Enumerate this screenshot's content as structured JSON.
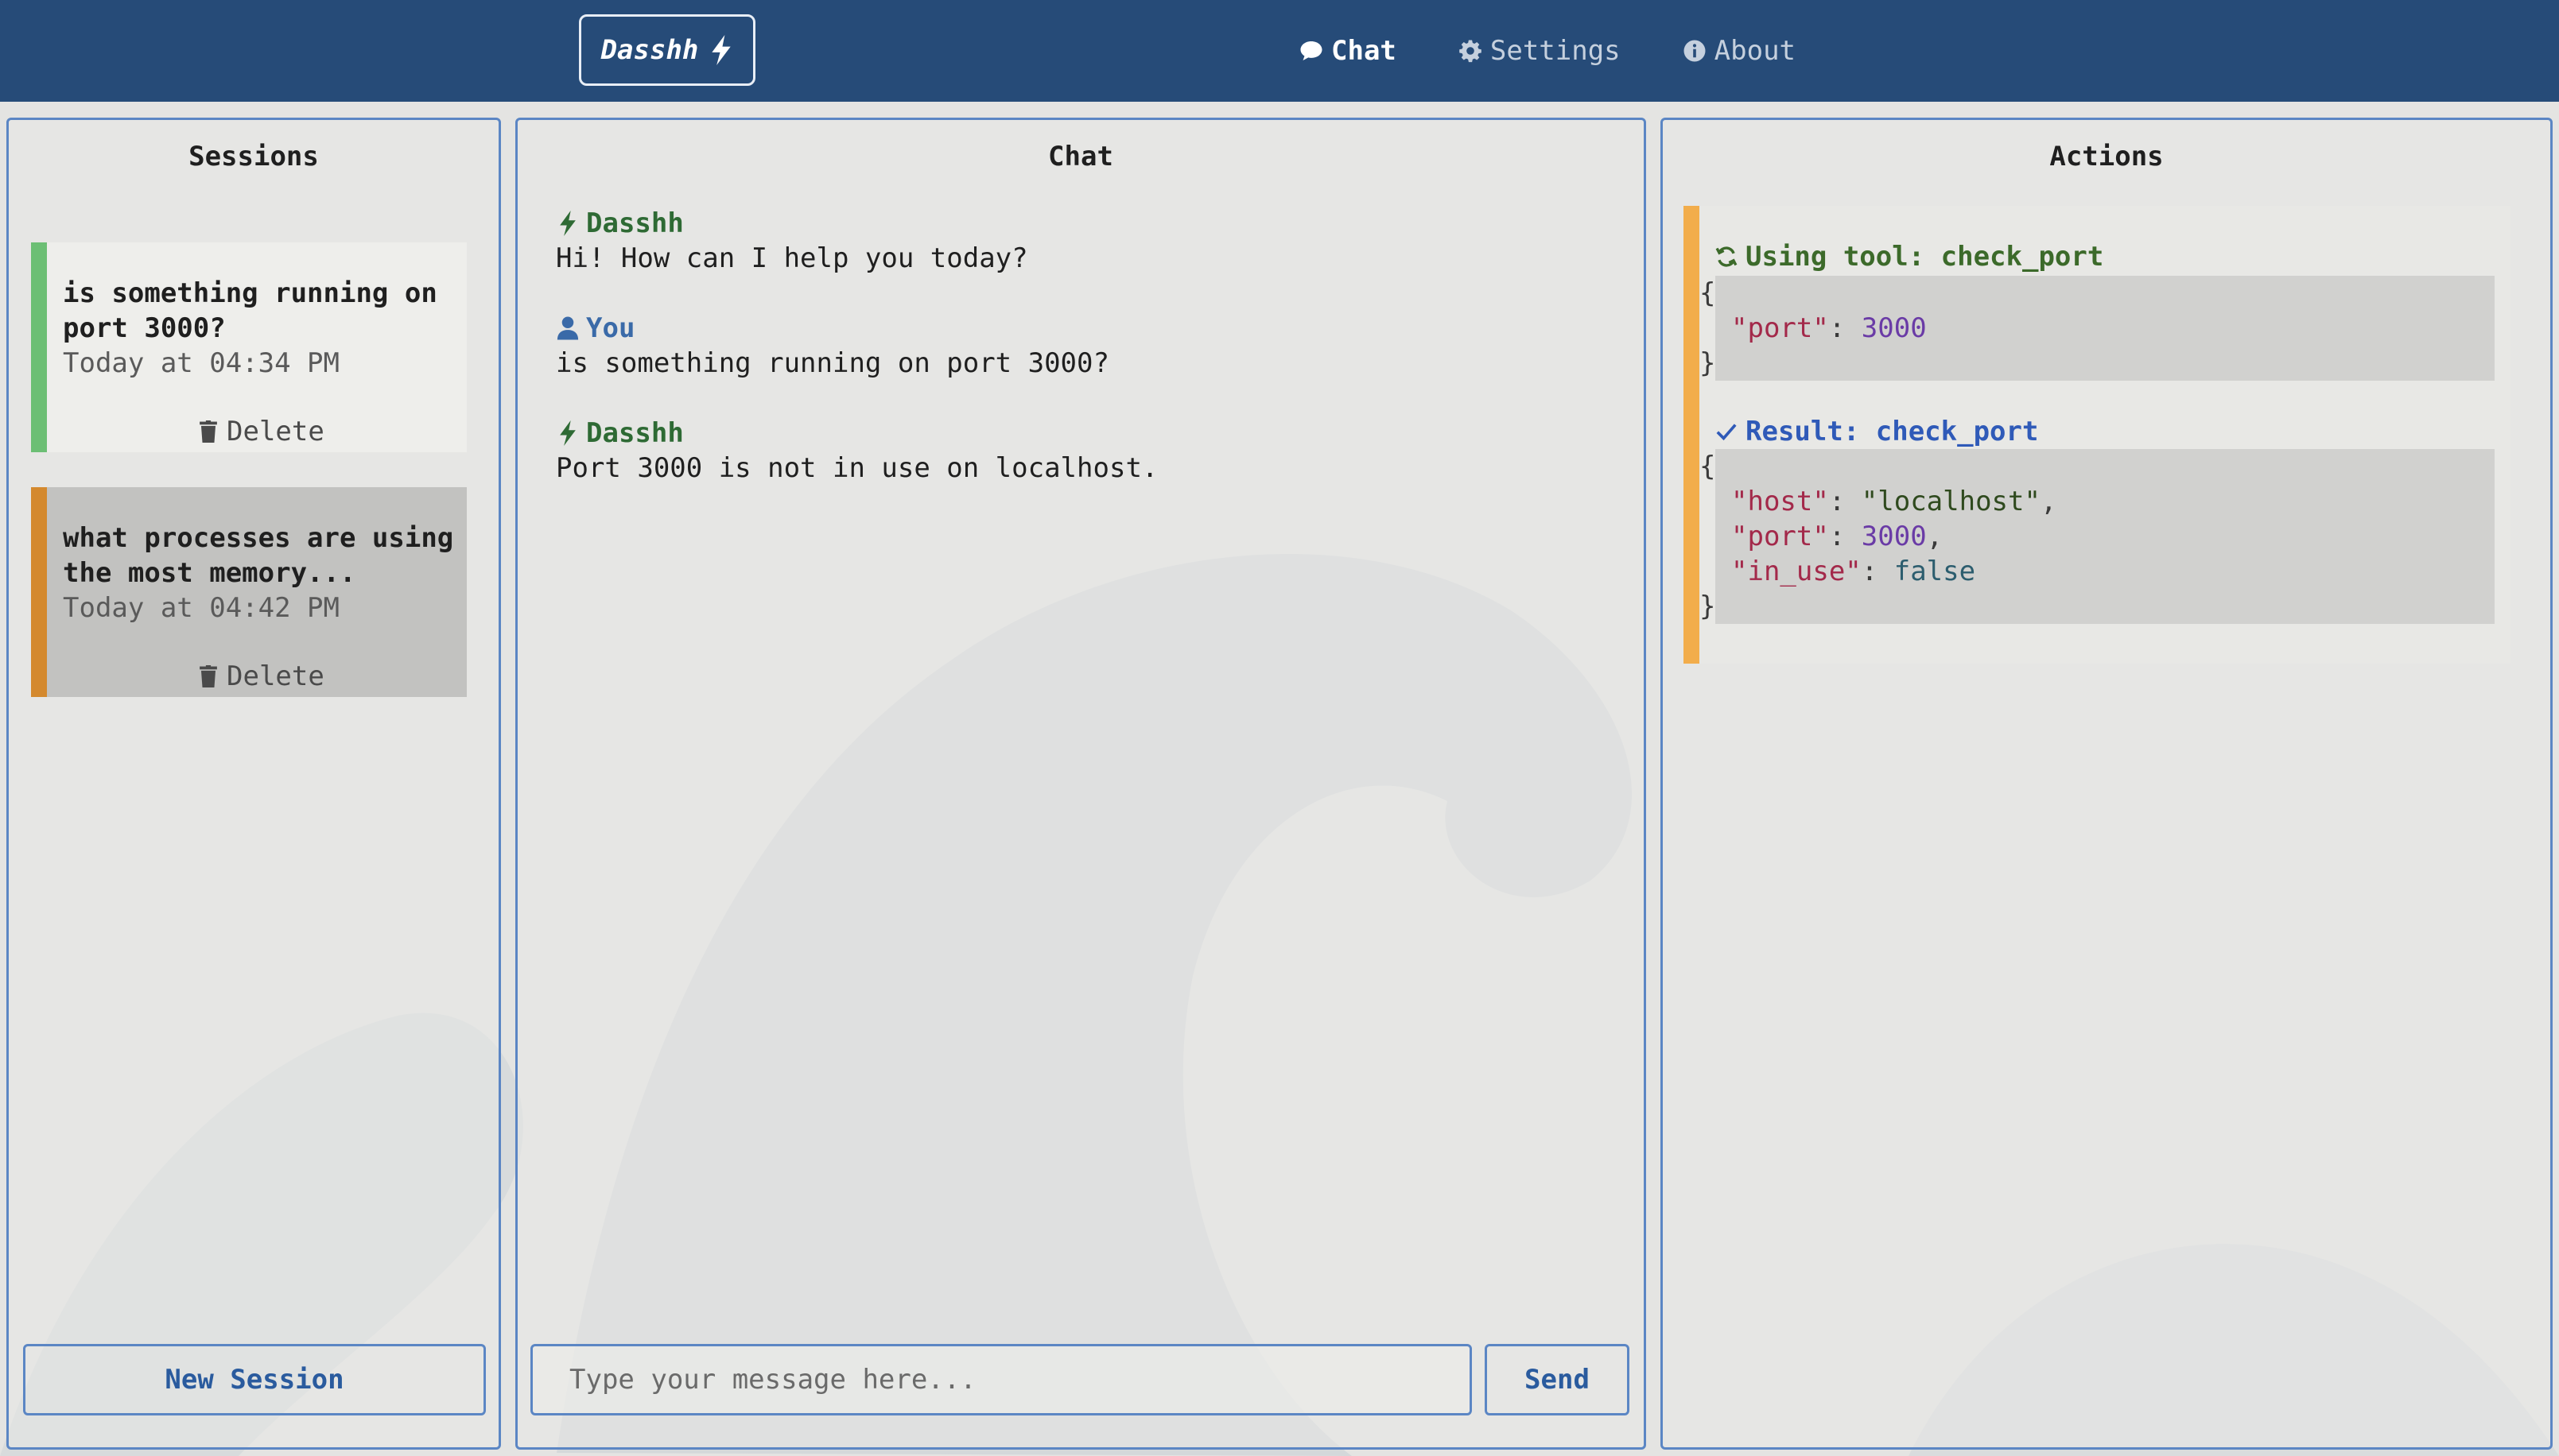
{
  "brand": {
    "name": "Dasshh"
  },
  "nav": {
    "chat": "Chat",
    "settings": "Settings",
    "about": "About"
  },
  "sessions": {
    "title": "Sessions",
    "items": [
      {
        "title": "is something running on port 3000?",
        "time": "Today at 04:34 PM",
        "delete_label": "Delete"
      },
      {
        "title": "what processes are using the most memory...",
        "time": "Today at 04:42 PM",
        "delete_label": "Delete"
      }
    ],
    "new_label": "New Session"
  },
  "chat": {
    "title": "Chat",
    "messages": [
      {
        "sender": "Dasshh",
        "text": "Hi! How can I help you today?"
      },
      {
        "sender": "You",
        "text": "is something running on port 3000?"
      },
      {
        "sender": "Dasshh",
        "text": "Port 3000 is not in use on localhost."
      }
    ],
    "input_placeholder": "Type your message here...",
    "send_label": "Send"
  },
  "actions": {
    "title": "Actions",
    "tool_label": "Using tool: check_port",
    "tool_args": {
      "port_key": "\"port\"",
      "port_val": "3000"
    },
    "result_label": "Result: check_port",
    "result": {
      "host_key": "\"host\"",
      "host_val": "\"localhost\"",
      "port_key": "\"port\"",
      "port_val": "3000",
      "in_use_key": "\"in_use\"",
      "in_use_val": "false"
    }
  },
  "colors": {
    "topbar": "#264b78",
    "panel_border": "#5b86c4",
    "active_session_accent": "#6cbf74",
    "other_session_accent": "#d4892e",
    "action_accent": "#f2ad4b"
  }
}
